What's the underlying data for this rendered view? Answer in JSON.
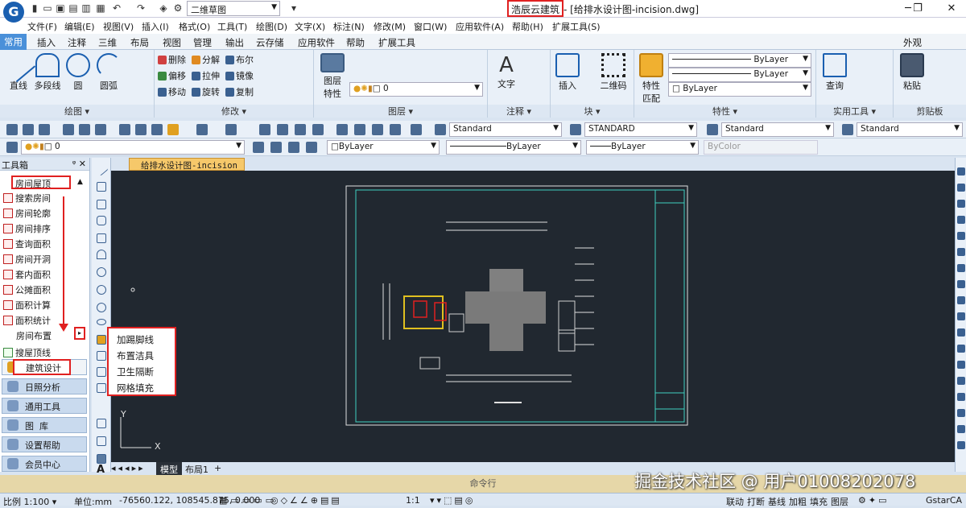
{
  "app": {
    "logo_letter": "G",
    "layout_select": "二维草图",
    "app_name": "浩辰云建筑",
    "file_title": "- [给排水设计图-incision.dwg]"
  },
  "menus": [
    "文件(F)",
    "编辑(E)",
    "视图(V)",
    "插入(I)",
    "格式(O)",
    "工具(T)",
    "绘图(D)",
    "文字(X)",
    "标注(N)",
    "修改(M)",
    "窗口(W)",
    "应用软件(A)",
    "帮助(H)",
    "扩展工具(S)"
  ],
  "tabs": [
    "常用",
    "插入",
    "注释",
    "三维",
    "布局",
    "视图",
    "管理",
    "输出",
    "云存储",
    "应用软件",
    "帮助",
    "扩展工具"
  ],
  "tabs_right": "外观",
  "ribbon": {
    "draw": {
      "label": "绘图",
      "buttons": [
        "直线",
        "多段线",
        "圆",
        "圆弧"
      ]
    },
    "modify": {
      "label": "修改",
      "rows": [
        [
          "删除",
          "分解",
          "布尔"
        ],
        [
          "偏移",
          "拉伸",
          "镜像"
        ],
        [
          "移动",
          "旋转",
          "复制"
        ]
      ]
    },
    "layer": {
      "label": "图层",
      "button": "图层\n特性",
      "combo": "0"
    },
    "annotate": {
      "label": "注释",
      "button": "文字"
    },
    "block": {
      "label": "块",
      "buttons": [
        "插入",
        "二维码"
      ]
    },
    "properties": {
      "label": "特性",
      "button": "特性\n匹配",
      "combos": [
        "ByLayer",
        "ByLayer",
        "ByLayer"
      ]
    },
    "utilities": {
      "label": "实用工具",
      "button": "查询"
    },
    "clipboard": {
      "label": "剪贴板",
      "button": "粘贴"
    }
  },
  "toolbar1": {
    "text_style": "Standard",
    "dim_style": "STANDARD",
    "table_style": "Standard",
    "ml_style": "Standard"
  },
  "toolbar2": {
    "layer": "0",
    "color": "ByLayer",
    "linetype": "ByLayer",
    "lineweight": "ByLayer",
    "plot": "ByColor"
  },
  "toolbox": {
    "title": "工具箱",
    "category": "房间屋顶",
    "items": [
      "搜索房间",
      "房间轮廓",
      "房间排序",
      "查询面积",
      "房间开洞",
      "套内面积",
      "公摊面积",
      "面积计算",
      "面积统计",
      "房间布置",
      "搜屋顶线"
    ],
    "active_category": "建筑设计",
    "categories": [
      "日照分析",
      "通用工具",
      "图  库",
      "设置帮助",
      "会员中心"
    ]
  },
  "popup": [
    "加踢脚线",
    "布置洁具",
    "卫生隔断",
    "网格填充"
  ],
  "document_tab": "给排水设计图-incision",
  "canvas": {
    "axis_y": "Y",
    "axis_x": "X"
  },
  "layout_tabs": [
    "模型",
    "布局1",
    "+"
  ],
  "command_line": "命令行",
  "status": {
    "scale": "比例 1:100",
    "unit": "单位:mm",
    "coords": "-76560.122, 108545.875, 0.000",
    "annot_scale": "1:1",
    "right_items": [
      "联动",
      "打断",
      "基线",
      "加粗",
      "填充",
      "图层"
    ],
    "brand": "GstarCA"
  },
  "watermark": "掘金技术社区 @ 用户01008202078",
  "colors": {
    "accent": "#4a90d9",
    "highlight": "#e02020",
    "canvas": "#212830",
    "cmd": "#e6d7a8"
  }
}
